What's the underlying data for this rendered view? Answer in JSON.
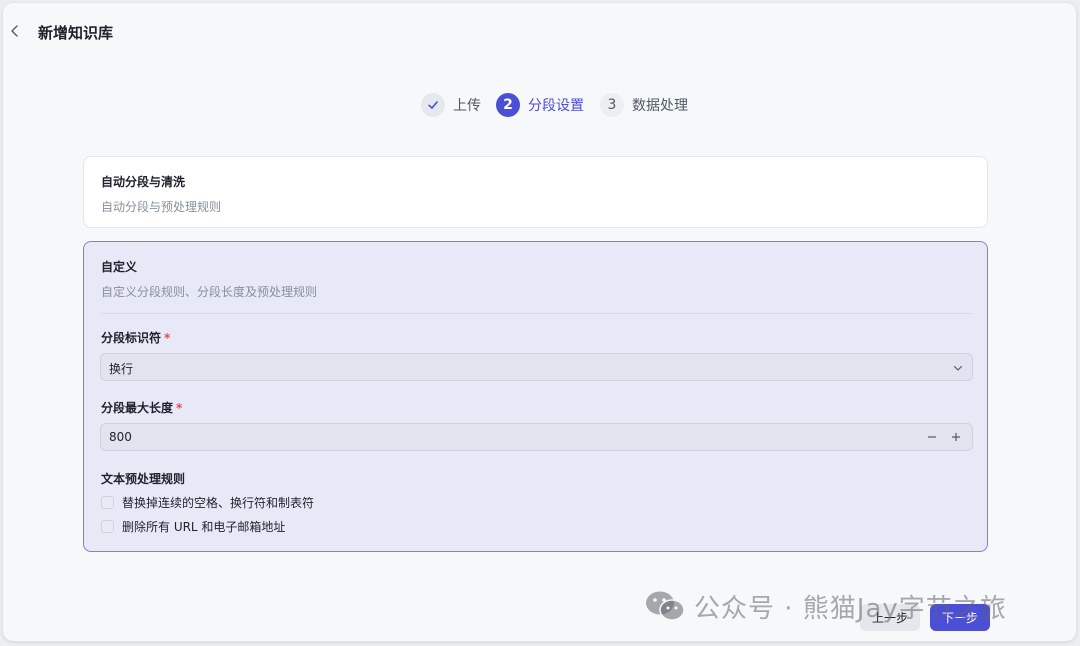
{
  "header": {
    "title": "新增知识库"
  },
  "icons": {
    "back": "chevron-left-icon",
    "check": "check-icon",
    "dropdown": "chevron-down-icon",
    "minus": "minus-icon",
    "plus": "plus-icon",
    "wechat": "wechat-icon"
  },
  "steps": [
    {
      "number": "1",
      "label": "上传",
      "state": "completed"
    },
    {
      "number": "2",
      "label": "分段设置",
      "state": "active"
    },
    {
      "number": "3",
      "label": "数据处理",
      "state": "pending"
    }
  ],
  "auto_option": {
    "title": "自动分段与清洗",
    "description": "自动分段与预处理规则"
  },
  "custom_option": {
    "title": "自定义",
    "description": "自定义分段规则、分段长度及预处理规则",
    "separator": {
      "label": "分段标识符",
      "required_mark": "*",
      "value": "换行"
    },
    "max_length": {
      "label": "分段最大长度",
      "required_mark": "*",
      "value": "800"
    },
    "preprocess": {
      "label": "文本预处理规则",
      "rules": [
        {
          "label": "替换掉连续的空格、换行符和制表符",
          "checked": false
        },
        {
          "label": "删除所有 URL 和电子邮箱地址",
          "checked": false
        }
      ]
    }
  },
  "footer": {
    "prev_label": "上一步",
    "next_label": "下一步"
  },
  "watermark": {
    "text": "公众号 · 熊猫Jay字节之旅"
  },
  "colors": {
    "accent": "#4b4fd6",
    "selected_card_bg": "#e8e9f7",
    "required": "#e5484d"
  }
}
